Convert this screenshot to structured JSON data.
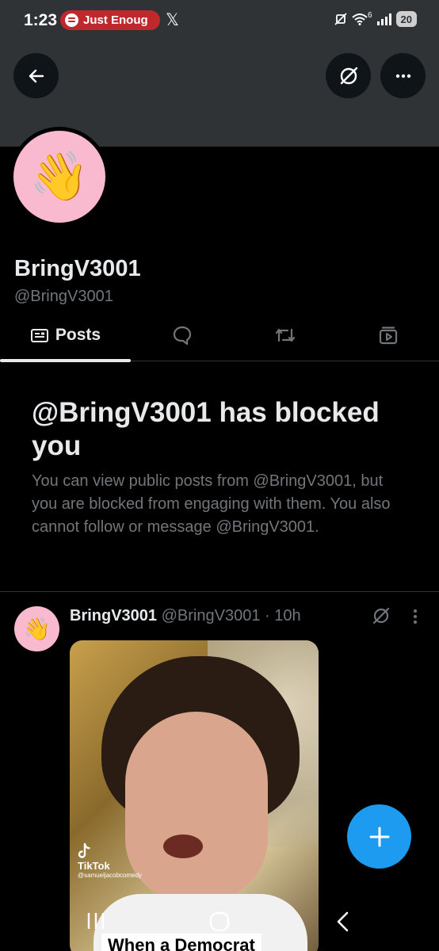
{
  "status_bar": {
    "time": "1:23",
    "media_text": "Just Enoug",
    "app_badge": "𝕏",
    "network_label": "6",
    "battery": "20"
  },
  "banner": {
    "back_icon": "arrow-left-icon",
    "grok_icon": "grok-icon",
    "more_icon": "more-horizontal-icon"
  },
  "profile": {
    "avatar_emoji": "👋",
    "display_name": "BringV3001",
    "handle": "@BringV3001"
  },
  "tabs": [
    {
      "label": "Posts",
      "icon": "posts-icon",
      "active": true
    },
    {
      "label": "",
      "icon": "reply-bubble-icon",
      "active": false
    },
    {
      "label": "",
      "icon": "repost-icon",
      "active": false
    },
    {
      "label": "",
      "icon": "media-icon",
      "active": false
    }
  ],
  "blocked": {
    "title": "@BringV3001 has blocked you",
    "body": "You can view public posts from @BringV3001, but you are blocked from engaging with them. You also cannot follow or message @BringV3001."
  },
  "post": {
    "avatar_emoji": "👋",
    "name": "BringV3001",
    "meta": "@BringV3001 · 10h",
    "media": {
      "watermark": "TikTok",
      "watermark_user": "@samueljacobcomedy",
      "caption": "When a Democrat"
    }
  },
  "fab": {
    "icon": "plus-icon"
  },
  "nav_bar": {
    "recents_icon": "recents-icon",
    "home_icon": "home-icon",
    "back_icon": "back-chevron-icon"
  },
  "colors": {
    "background": "#000000",
    "banner": "#2f3336",
    "accent": "#1d9bf0",
    "muted_text": "#71767b",
    "primary_text": "#e7e9ea",
    "avatar_bg": "#f9b9cf",
    "media_pill": "#c0292b"
  }
}
